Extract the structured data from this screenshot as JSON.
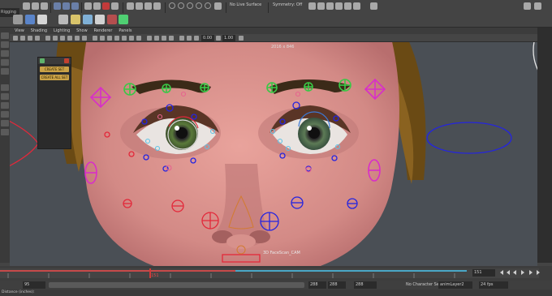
{
  "statusbar": {
    "mode": "Rigging",
    "live_surface": "No Live Surface",
    "symmetry": "Symmetry: Off"
  },
  "panel_menu": [
    "View",
    "Shading",
    "Lighting",
    "Show",
    "Renderer",
    "Panels"
  ],
  "panel_toolbar": {
    "near_value": "0.00",
    "far_value": "1.00"
  },
  "viewport": {
    "resolution_label": "2016 x 846",
    "camera_label": "3D FaceScan_CAM"
  },
  "set_panel": {
    "create_set": "CREATE SET",
    "create_all_set": "CREATE ALL SET"
  },
  "timeline": {
    "current_frame": "151",
    "end_frame_field": "151"
  },
  "range": {
    "start_field": "95",
    "min_field": "",
    "max_inner": "288",
    "max_outer": "288",
    "end_field": "288",
    "character_set": "No Character Set",
    "anim_layer": "animLayer2",
    "fps": "24 fps"
  },
  "helpline": {
    "text": "Distance (inches):"
  },
  "colors": {
    "accent_green": "#39c846",
    "accent_magenta": "#d82ec9",
    "accent_blue": "#2424e0",
    "accent_red": "#e3283a",
    "timeline_red": "#c64a4a",
    "timeline_blue": "#4aa7c6"
  }
}
